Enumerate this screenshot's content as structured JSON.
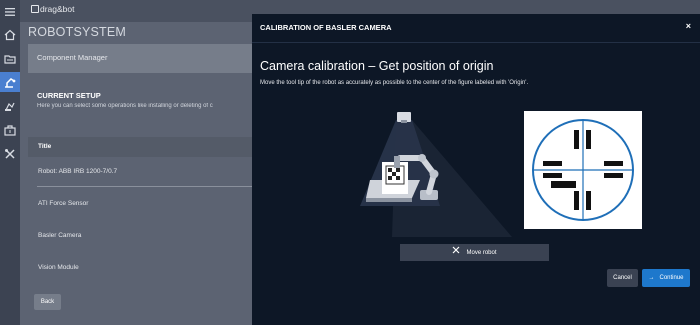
{
  "app": {
    "logo_text": "drag&bot",
    "section_title": "ROBOTSYSTEM"
  },
  "nav": {
    "items": [
      {
        "name": "menu-icon"
      },
      {
        "name": "home-icon"
      },
      {
        "name": "folder-icon"
      },
      {
        "name": "robot-arm-icon",
        "active": true
      },
      {
        "name": "skill-icon"
      },
      {
        "name": "toolbox-icon"
      },
      {
        "name": "tools-icon"
      }
    ]
  },
  "page": {
    "component_manager": "Component Manager",
    "current_setup": "CURRENT SETUP",
    "description": "Here you can select some operations like installing or deleting of c",
    "table": {
      "header": "Title",
      "rows": [
        "Robot: ABB IRB 1200-7/0.7",
        "ATI Force Sensor",
        "Basler Camera",
        "Vision Module"
      ]
    },
    "back_label": "Back"
  },
  "modal": {
    "title": "CALIBRATION OF BASLER CAMERA",
    "close_label": "×",
    "heading": "Camera calibration – Get position of origin",
    "instruction": "Move the tool tip of the robot as accurately as possible to the center of the figure labeled with 'Origin'.",
    "move_robot_label": "Move robot",
    "cancel_label": "Cancel",
    "continue_label": "Continue",
    "continue_arrow": "→"
  },
  "colors": {
    "accent": "#1e78cc",
    "modal_bg": "#0d1726",
    "rail_bg": "#3c4352"
  }
}
